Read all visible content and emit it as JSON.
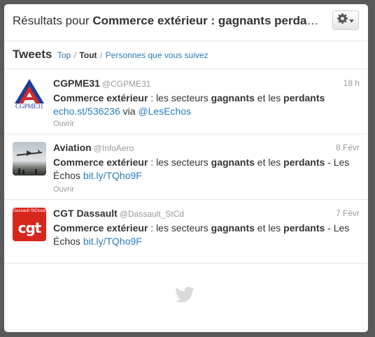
{
  "header": {
    "title_prefix": "Résultats pour ",
    "query": "Commerce extérieur : gagnants perdants",
    "settings_icon": "gear-icon",
    "dropdown_icon": "caret-down-icon"
  },
  "tabs": {
    "title": "Tweets",
    "items": [
      {
        "label": "Top",
        "active": false
      },
      {
        "label": "Tout",
        "active": true
      },
      {
        "label": "Personnes que vous suivez",
        "active": false
      }
    ],
    "separator": "/"
  },
  "tweets": [
    {
      "name": "CGPME31",
      "handle": "@CGPME31",
      "time": "18 h",
      "avatar_text": "CGPME31",
      "text": [
        {
          "t": "Commerce extérieur",
          "b": true
        },
        {
          "t": "  : les secteurs ",
          "b": false
        },
        {
          "t": "gagnants",
          "b": true
        },
        {
          "t": " et les ",
          "b": false
        },
        {
          "t": "perdants",
          "b": true
        },
        {
          "t": " ",
          "b": false
        }
      ],
      "link": "echo.st/536236",
      "after_link": " via ",
      "mention": "@LesEchos",
      "open_label": "Ouvrir"
    },
    {
      "name": "Aviation",
      "handle": "@InfoAero",
      "time": "8 Févr",
      "text": [
        {
          "t": "Commerce extérieur",
          "b": true
        },
        {
          "t": " : les secteurs ",
          "b": false
        },
        {
          "t": "gagnants",
          "b": true
        },
        {
          "t": " et les ",
          "b": false
        },
        {
          "t": "perdants",
          "b": true
        },
        {
          "t": " - Les Échos ",
          "b": false
        }
      ],
      "link": "bit.ly/TQho9F",
      "open_label": "Ouvrir"
    },
    {
      "name": "CGT Dassault",
      "handle": "@Dassault_StCd",
      "time": "7 Févr",
      "avatar_text_top": "Dassault StCloud",
      "avatar_text": "cgt",
      "text": [
        {
          "t": "Commerce extérieur",
          "b": true
        },
        {
          "t": " : les secteurs ",
          "b": false
        },
        {
          "t": "gagnants",
          "b": true
        },
        {
          "t": " et les ",
          "b": false
        },
        {
          "t": "perdants",
          "b": true
        },
        {
          "t": " - Les Échos ",
          "b": false
        }
      ],
      "link": "bit.ly/TQho9F",
      "open_label": "Ouvrir"
    }
  ],
  "footer": {
    "icon": "twitter-bird-icon"
  },
  "colors": {
    "link": "#2b7bb9",
    "text": "#333333",
    "muted": "#999999",
    "cgt_red": "#d9261c",
    "cgpme_blue": "#1c3f94",
    "cgpme_red": "#d42a2a",
    "bird": "#dadada"
  }
}
